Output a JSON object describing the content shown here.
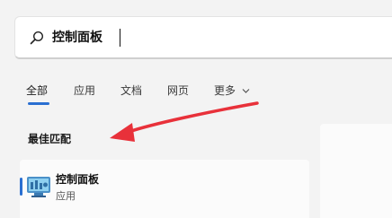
{
  "search": {
    "value": "控制面板",
    "icon": "search-icon"
  },
  "tabs": [
    {
      "label": "全部",
      "active": true
    },
    {
      "label": "应用",
      "active": false
    },
    {
      "label": "文档",
      "active": false
    },
    {
      "label": "网页",
      "active": false
    },
    {
      "label": "更多",
      "active": false
    }
  ],
  "section": {
    "heading": "最佳匹配"
  },
  "best_match": {
    "title": "控制面板",
    "subtitle": "应用",
    "icon": "control-panel-icon"
  },
  "colors": {
    "accent": "#2a6fd1",
    "arrow": "#e8313a",
    "background": "#f3f3f3"
  }
}
